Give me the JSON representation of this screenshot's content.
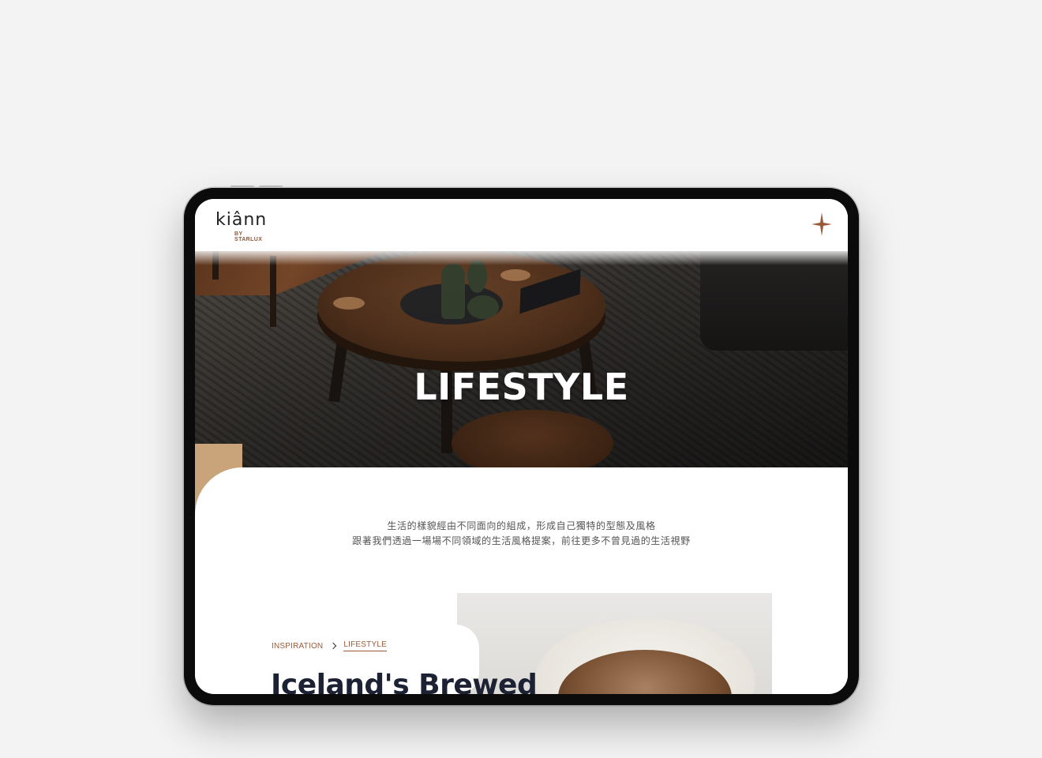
{
  "header": {
    "logo_word": "kiânn",
    "logo_sub": "BY STARLUX"
  },
  "hero": {
    "title": "LIFESTYLE"
  },
  "intro": {
    "line1": "生活的樣貌經由不同面向的組成，形成自己獨特的型態及風格",
    "line2": "跟著我們透過一場場不同領域的生活風格提案，前往更多不曾見過的生活視野"
  },
  "breadcrumb": {
    "items": [
      "INSPIRATION",
      "LIFESTYLE"
    ]
  },
  "article": {
    "title": "Iceland's Brewed"
  },
  "colors": {
    "accent_brown": "#9a5a3a",
    "gold": "#c9a47a",
    "title_navy": "#1c2233"
  },
  "icons": {
    "header_right": "four-point-star-icon",
    "breadcrumb_separator": "chevron-right-icon"
  }
}
